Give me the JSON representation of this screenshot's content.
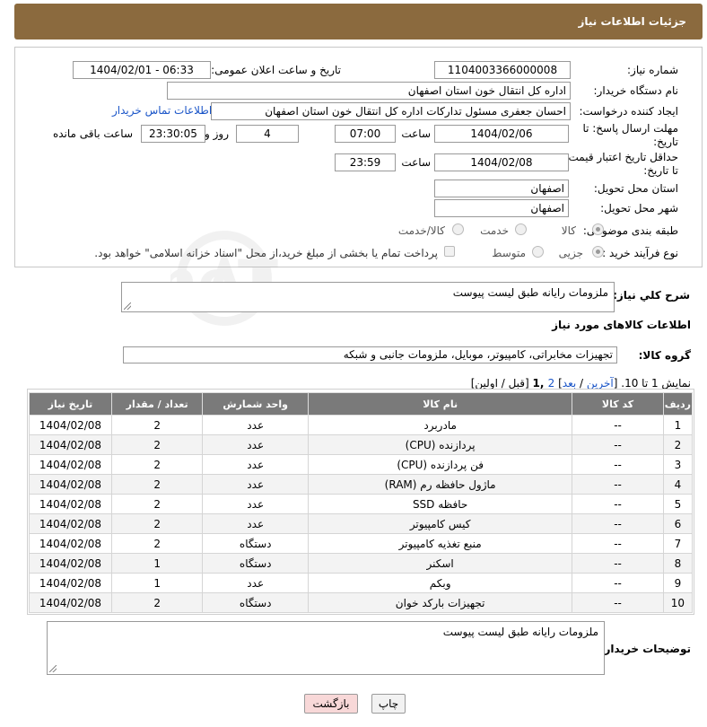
{
  "header": {
    "title": "جزئیات اطلاعات نیاز"
  },
  "form": {
    "need_number_label": "شماره نیاز:",
    "need_number": "1104003366000008",
    "announce_label": "تاریخ و ساعت اعلان عمومی:",
    "announce_value": "1404/02/01 - 06:33",
    "buyer_org_label": "نام دستگاه خریدار:",
    "buyer_org": "اداره کل انتقال خون استان اصفهان",
    "creator_label": "ایجاد کننده درخواست:",
    "creator": "احسان جعفری مسئول تدارکات اداره کل انتقال خون استان اصفهان",
    "contact_link": "اطلاعات تماس خریدار",
    "reply_deadline_label_1": "مهلت ارسال پاسخ: تا",
    "reply_deadline_label_2": "تاریخ:",
    "reply_date": "1404/02/06",
    "time_label": "ساعت",
    "reply_time": "07:00",
    "days_value": "4",
    "days_label": "روز و",
    "remaining_time": "23:30:05",
    "remaining_label": "ساعت باقی مانده",
    "price_validity_label_1": "حداقل تاریخ اعتبار قیمت:",
    "price_validity_label_2": "تا تاریخ:",
    "price_date": "1404/02/08",
    "price_time_label": "ساعت",
    "price_time": "23:59",
    "province_label": "استان محل تحویل:",
    "province": "اصفهان",
    "city_label": "شهر محل تحویل:",
    "city": "اصفهان",
    "category_label": "طبقه بندی موضوعی:",
    "category_options": [
      "کالا",
      "خدمت",
      "کالا/خدمت"
    ],
    "process_label": "نوع فرآیند خرید :",
    "process_options": [
      "جزیی",
      "متوسط"
    ],
    "payment_note": "پرداخت تمام یا بخشی از مبلغ خرید،از محل \"اسناد خزانه اسلامی\" خواهد بود."
  },
  "summary": {
    "label": "شرح کلي نیاز:",
    "text": "ملزومات رایانه طبق لیست پیوست"
  },
  "goods": {
    "section_title": "اطلاعات کالاهای مورد نیاز",
    "group_label": "گروه کالا:",
    "group_value": "تجهیزات مخابراتی، کامپیوتر، موبایل، ملزومات جانبی و شبکه"
  },
  "pagination": {
    "prefix": "نمایش 1 تا 10. [",
    "last": "آخرین",
    "sep1": " / ",
    "next": "بعد",
    "sep2": "] ",
    "page2": "2",
    "page1": " ,1",
    "suffix": " [قبل / اولین]"
  },
  "table": {
    "headers": [
      "ردیف",
      "کد کالا",
      "نام کالا",
      "واحد شمارش",
      "تعداد / مقدار",
      "تاریخ نیاز"
    ],
    "rows": [
      [
        "1",
        "--",
        "مادربرد",
        "عدد",
        "2",
        "1404/02/08"
      ],
      [
        "2",
        "--",
        "پردازنده (CPU)",
        "عدد",
        "2",
        "1404/02/08"
      ],
      [
        "3",
        "--",
        "فن پردازنده (CPU)",
        "عدد",
        "2",
        "1404/02/08"
      ],
      [
        "4",
        "--",
        "ماژول حافظه رم (RAM)",
        "عدد",
        "2",
        "1404/02/08"
      ],
      [
        "5",
        "--",
        "حافظه SSD",
        "عدد",
        "2",
        "1404/02/08"
      ],
      [
        "6",
        "--",
        "کیس کامپیوتر",
        "عدد",
        "2",
        "1404/02/08"
      ],
      [
        "7",
        "--",
        "منبع تغذیه کامپیوتر",
        "دستگاه",
        "2",
        "1404/02/08"
      ],
      [
        "8",
        "--",
        "اسکنر",
        "دستگاه",
        "1",
        "1404/02/08"
      ],
      [
        "9",
        "--",
        "وبکم",
        "عدد",
        "1",
        "1404/02/08"
      ],
      [
        "10",
        "--",
        "تجهیزات بارکد خوان",
        "دستگاه",
        "2",
        "1404/02/08"
      ]
    ]
  },
  "buyer_notes": {
    "label": "توضیحات خریدار:",
    "text": "ملزومات رایانه طبق لیست پیوست"
  },
  "buttons": {
    "print": "چاپ",
    "back": "بازگشت"
  },
  "watermark": {
    "text": "AriaTender.neT"
  },
  "colors": {
    "header_bg": "#8b6a3e",
    "table_header_bg": "#7a7a7a",
    "back_button_bg": "#f8d8d8",
    "link": "#1a55c8"
  }
}
